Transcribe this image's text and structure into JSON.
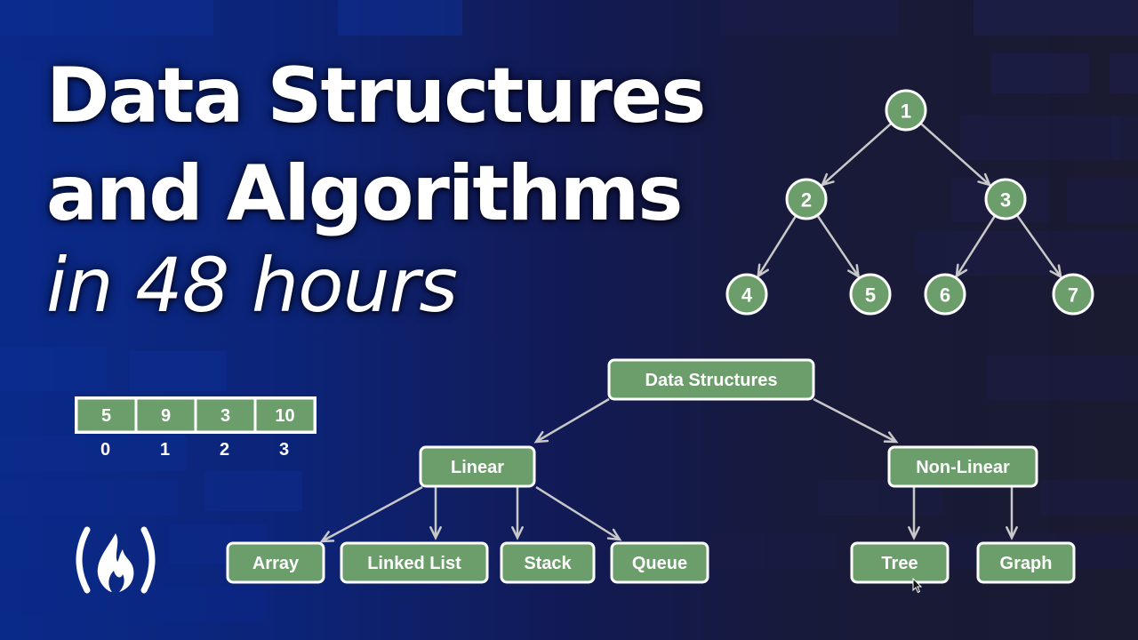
{
  "title": {
    "line1": "Data Structures",
    "line2": "and Algorithms",
    "line3": "in 48 hours"
  },
  "colors": {
    "node_fill": "#6b9e6b",
    "node_stroke": "#ffffff",
    "edge": "#c8c8c8",
    "text": "#ffffff"
  },
  "binary_tree": {
    "nodes": [
      "1",
      "2",
      "3",
      "4",
      "5",
      "6",
      "7"
    ],
    "edges": [
      [
        "1",
        "2"
      ],
      [
        "1",
        "3"
      ],
      [
        "2",
        "4"
      ],
      [
        "2",
        "5"
      ],
      [
        "3",
        "6"
      ],
      [
        "3",
        "7"
      ]
    ]
  },
  "array": {
    "values": [
      "5",
      "9",
      "3",
      "10"
    ],
    "indices": [
      "0",
      "1",
      "2",
      "3"
    ]
  },
  "hierarchy": {
    "root": "Data Structures",
    "categories": [
      {
        "label": "Linear",
        "children": [
          "Array",
          "Linked List",
          "Stack",
          "Queue"
        ]
      },
      {
        "label": "Non-Linear",
        "children": [
          "Tree",
          "Graph"
        ]
      }
    ]
  },
  "logo": {
    "icon": "freecodecamp-flame-icon"
  },
  "cursor": {
    "icon": "mouse-pointer-icon"
  }
}
